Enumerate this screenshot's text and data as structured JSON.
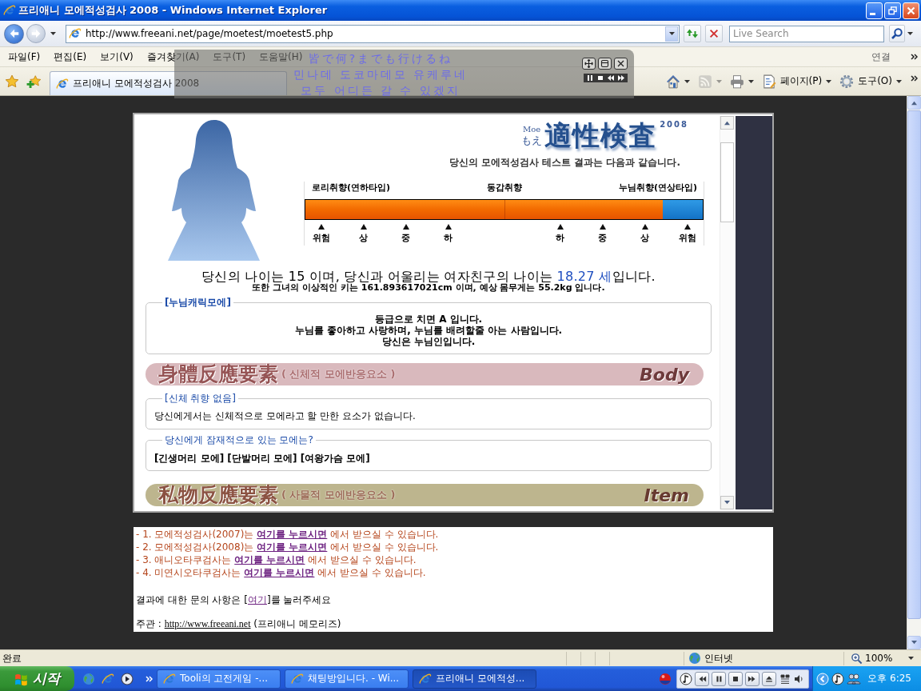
{
  "window": {
    "title": "프리애니 모에적성검사 2008 - Windows Internet Explorer"
  },
  "address_bar": {
    "url": "http://www.freeani.net/page/moetest/moetest5.php"
  },
  "search": {
    "placeholder": "Live Search"
  },
  "menu": [
    {
      "label": "파일(F)"
    },
    {
      "label": "편집(E)"
    },
    {
      "label": "보기(V)"
    },
    {
      "label": "즐겨찾기(A)"
    },
    {
      "label": "도구(T)"
    },
    {
      "label": "도움말(H)"
    }
  ],
  "links_bar": {
    "label": "연결"
  },
  "tabs": [
    {
      "label": "프리애니 모에적성검사 2008",
      "selected": true
    }
  ],
  "commands": [
    {
      "kind": "home",
      "disabled": false
    },
    {
      "kind": "feeds",
      "disabled": true
    },
    {
      "kind": "print",
      "disabled": false
    },
    {
      "kind": "page",
      "label": "페이지(P)",
      "disabled": false
    },
    {
      "kind": "tools",
      "label": "도구(O)",
      "disabled": false
    }
  ],
  "lyrics_overlay": {
    "lines": [
      "皆で何?までも行けるね",
      "민나데 도코마데모 유케루네",
      "모두 어디든 갈 수 있겠지"
    ]
  },
  "test_frame": {
    "logo": {
      "latin": "Moe",
      "kana": "もえ",
      "title": "適性検査",
      "year": "2008"
    },
    "intro": "당신의 모에적성검사 테스트 결과는 다음과 같습니다.",
    "scale": {
      "left_label": "로리취향(연하타입)",
      "center_label": "동갑취향",
      "right_label": "누님취향(연상타입)",
      "level": 0.9,
      "ticks_left": [
        "위험",
        "상",
        "중",
        "하"
      ],
      "ticks_right": [
        "하",
        "중",
        "상",
        "위험"
      ]
    },
    "age_sentence": {
      "before": "당신의 나이는 15 이며, 당신과 어울리는 여자친구의 나이는 ",
      "highlight": "18.27 세",
      "after": "입니다."
    },
    "ideal_sentence": "또한 그녀의 이상적인 키는 161.893617021cm 이며, 예상 몸무게는 55.2kg 입니다.",
    "blocks": [
      {
        "kind": "result",
        "legend": "[누님캐릭모에]",
        "lines": [
          "등급으로 치면 A 입니다.",
          "누님를 좋아하고 사랑하며, 누님를 배려할줄 아는 사람입니다.",
          "당신은 누님인입니다."
        ]
      },
      {
        "kind": "banner",
        "title": "身體反應要素",
        "subtitle": "( 신체적 모에반응요소 )",
        "tag": "Body",
        "color": "#d9b9bd"
      },
      {
        "kind": "note",
        "legend": "[신체 취향 없음]",
        "lines": [
          "당신에게서는 신체적으로 모에라고 할 만한 요소가 없습니다."
        ]
      },
      {
        "kind": "tags",
        "legend": "당신에게 잠재적으로 있는 모에는?",
        "lines": [
          "[긴생머리 모에] [단발머리 모에] [여왕가슴 모에]"
        ]
      },
      {
        "kind": "banner",
        "title": "私物反應要素",
        "subtitle": "( 사물적 모에반응요소 )",
        "tag": "Item",
        "color": "#bdb58e"
      }
    ]
  },
  "info_box": {
    "downloads": [
      {
        "before": "- 1. 모에적성검사(2007)는 ",
        "link": "여기를 누르시면",
        "after": " 에서 받으실 수 있습니다."
      },
      {
        "before": "- 2. 모에적성검사(2008)는 ",
        "link": "여기를 누르시면",
        "after": " 에서 받으실 수 있습니다."
      },
      {
        "before": "- 3. 애니오타쿠검사는 ",
        "link": "여기를 누르시면",
        "after": " 에서 받으실 수 있습니다."
      },
      {
        "before": "- 4. 미연시오타쿠검사는 ",
        "link": "여기를 누르시면",
        "after": " 에서 받으실 수 있습니다."
      }
    ],
    "inquiry": {
      "before": "결과에 대한 문의 사항은 [",
      "link": "여기",
      "after": "]를 눌러주세요"
    },
    "host": {
      "before": "주관 : ",
      "link": "http://www.freeani.net",
      "after": " (프리애니 메모리즈)"
    }
  },
  "status_bar": {
    "status": "완료",
    "zone": "인터넷",
    "zoom": "100%"
  },
  "taskbar": {
    "start": "시작",
    "tasks": [
      {
        "label": "Tooli의 고전게임 -...",
        "selected": false
      },
      {
        "label": "채팅방입니다. - Wi...",
        "selected": false
      },
      {
        "label": "프리애니 모에적성...",
        "selected": true
      }
    ],
    "clock": "오후 6:25"
  }
}
